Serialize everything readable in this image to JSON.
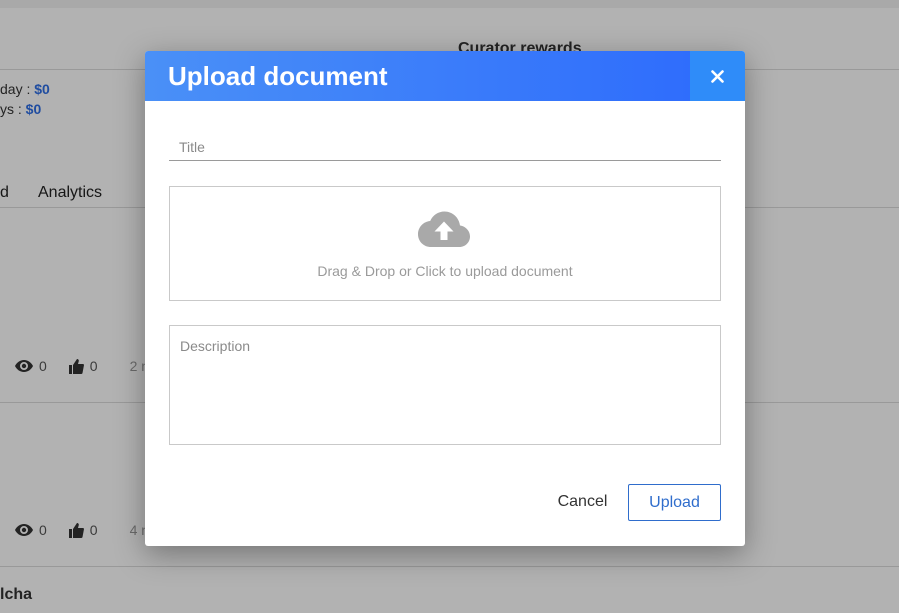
{
  "background": {
    "curator_rewards_heading": "Curator rewards",
    "rewards_day_label": "day : ",
    "rewards_day_value": "$0",
    "rewards_days_label": "ys : ",
    "rewards_days_value": "$0",
    "tab_partial": "d",
    "tab_analytics": "Analytics",
    "posts": [
      {
        "views": "0",
        "likes": "0",
        "time_partial": "2 n"
      },
      {
        "views": "0",
        "likes": "0",
        "time_partial": "4 n"
      }
    ],
    "author_partial": "lcha"
  },
  "modal": {
    "title": "Upload document",
    "title_placeholder": "Title",
    "dropzone_text": "Drag & Drop or Click to upload document",
    "description_placeholder": "Description",
    "cancel_label": "Cancel",
    "upload_label": "Upload",
    "close_icon": "close-icon",
    "cloud_icon": "cloud-upload-icon"
  },
  "colors": {
    "header_start": "#4a90f7",
    "header_end": "#2f6dfc",
    "close_bg": "#2f8cf9",
    "accent": "#2f6dcc",
    "money": "#2f6fe6"
  }
}
